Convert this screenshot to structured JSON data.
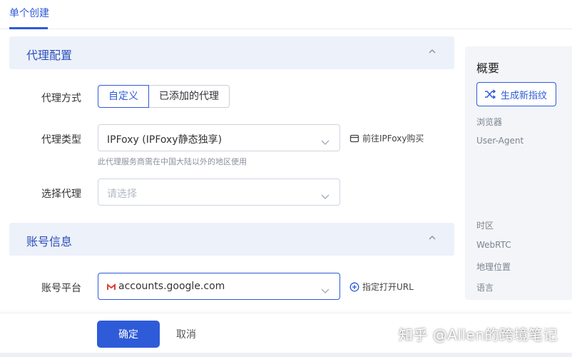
{
  "tabs": {
    "active_label": "单个创建"
  },
  "proxy_section": {
    "title": "代理配置",
    "method_label": "代理方式",
    "method_options": [
      "自定义",
      "已添加的代理"
    ],
    "type_label": "代理类型",
    "type_value": "IPFoxy (IPFoxy静态独享)",
    "type_hint": "此代理服务商需在中国大陆以外的地区使用",
    "type_link": "前往IPFoxy购买",
    "select_label": "选择代理",
    "select_placeholder": "请选择"
  },
  "account_section": {
    "title": "账号信息",
    "platform_label": "账号平台",
    "platform_value": "accounts.google.com",
    "platform_link": "指定打开URL"
  },
  "right_panel": {
    "title": "概要",
    "generate_button": "生成新指纹",
    "labels": [
      "浏览器",
      "User-Agent",
      "时区",
      "WebRTC",
      "地理位置",
      "语言"
    ]
  },
  "footer": {
    "confirm_label": "确定",
    "cancel_label": "取消",
    "watermark": "知乎 @Allen的跨境笔记"
  },
  "colors": {
    "accent": "#2e5bd8",
    "section_bg": "#edf1fa",
    "panel_bg": "#f3f5f8"
  }
}
